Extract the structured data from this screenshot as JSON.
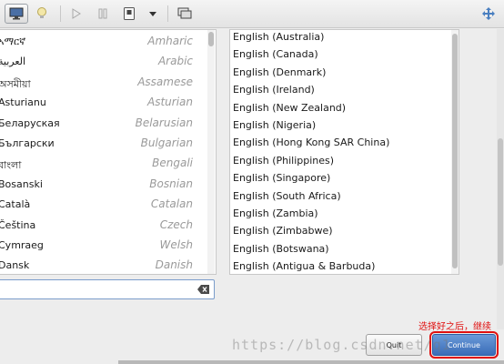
{
  "toolbar": {
    "icons": [
      "monitor-icon",
      "lightbulb-icon",
      "play-icon",
      "pause-icon",
      "power-icon",
      "dropdown-arrow-icon",
      "screens-icon",
      "move-arrows-icon"
    ]
  },
  "languages": [
    {
      "native": "ኣማርኛ",
      "english": "Amharic"
    },
    {
      "native": "العربية",
      "english": "Arabic"
    },
    {
      "native": "অসমীয়া",
      "english": "Assamese"
    },
    {
      "native": "Asturianu",
      "english": "Asturian"
    },
    {
      "native": "Беларуская",
      "english": "Belarusian"
    },
    {
      "native": "Български",
      "english": "Bulgarian"
    },
    {
      "native": "বাংলা",
      "english": "Bengali"
    },
    {
      "native": "Bosanski",
      "english": "Bosnian"
    },
    {
      "native": "Català",
      "english": "Catalan"
    },
    {
      "native": "Čeština",
      "english": "Czech"
    },
    {
      "native": "Cymraeg",
      "english": "Welsh"
    },
    {
      "native": "Dansk",
      "english": "Danish"
    }
  ],
  "locales": [
    "English (Australia)",
    "English (Canada)",
    "English (Denmark)",
    "English (Ireland)",
    "English (New Zealand)",
    "English (Nigeria)",
    "English (Hong Kong SAR China)",
    "English (Philippines)",
    "English (Singapore)",
    "English (South Africa)",
    "English (Zambia)",
    "English (Zimbabwe)",
    "English (Botswana)",
    "English (Antigua & Barbuda)"
  ],
  "search": {
    "value": "",
    "placeholder": ""
  },
  "annotation": "选择好之后，继续",
  "buttons": {
    "quit": "Quit",
    "continue": "Continue"
  },
  "watermark": "https://blog.csdn.net/q1"
}
